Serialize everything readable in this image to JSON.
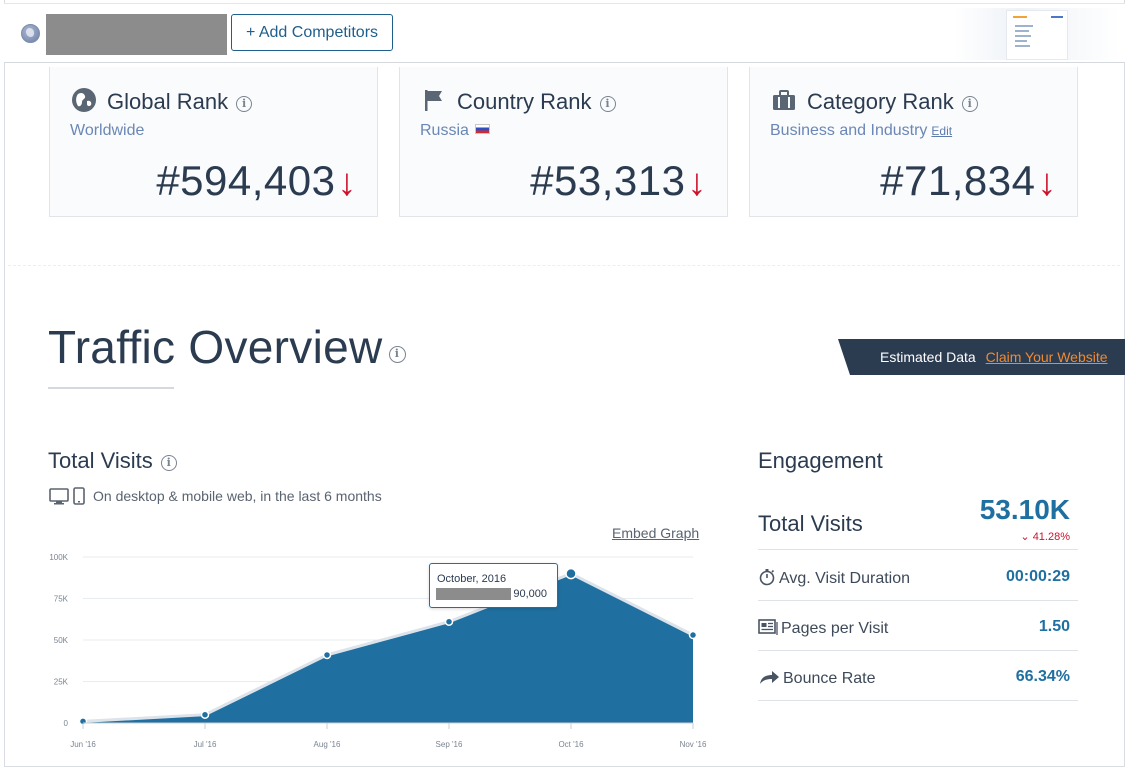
{
  "header": {
    "add_competitors_label": "+ Add Competitors"
  },
  "ranks": [
    {
      "title": "Global Rank",
      "subtitle": "Worldwide",
      "value": "#594,403",
      "trend": "down"
    },
    {
      "title": "Country Rank",
      "subtitle": "Russia",
      "value": "#53,313",
      "trend": "down"
    },
    {
      "title": "Category Rank",
      "subtitle": "Business and Industry",
      "edit_label": "Edit",
      "value": "#71,834",
      "trend": "down"
    }
  ],
  "traffic_overview": {
    "title": "Traffic Overview",
    "estimated_label": "Estimated Data",
    "claim_label": "Claim Your Website"
  },
  "total_visits": {
    "title": "Total Visits",
    "subtitle": "On desktop & mobile web, in the last 6 months",
    "embed_label": "Embed Graph",
    "tooltip": {
      "date": "October, 2016",
      "value": "90,000"
    }
  },
  "chart_data": {
    "type": "area",
    "categories": [
      "Jun '16",
      "Jul '16",
      "Aug '16",
      "Sep '16",
      "Oct '16",
      "Nov '16"
    ],
    "values": [
      1000,
      5000,
      41000,
      61000,
      90000,
      53000
    ],
    "ylim": [
      0,
      100000
    ],
    "yticks": [
      "0",
      "25K",
      "50K",
      "75K",
      "100K"
    ],
    "grid": true,
    "color": "#1f6fa0"
  },
  "engagement": {
    "title": "Engagement",
    "total_visits_label": "Total Visits",
    "total_visits_value": "53.10K",
    "total_visits_change": "41.28%",
    "rows": [
      {
        "label": "Avg. Visit Duration",
        "value": "00:00:29",
        "icon": "stopwatch-icon"
      },
      {
        "label": "Pages per Visit",
        "value": "1.50",
        "icon": "pages-icon"
      },
      {
        "label": "Bounce Rate",
        "value": "66.34%",
        "icon": "bounce-arrow-icon"
      }
    ]
  },
  "colors": {
    "accent": "#1f6fa0",
    "down": "#d0112b",
    "claim": "#f08a32",
    "dark": "#2b3b50"
  }
}
